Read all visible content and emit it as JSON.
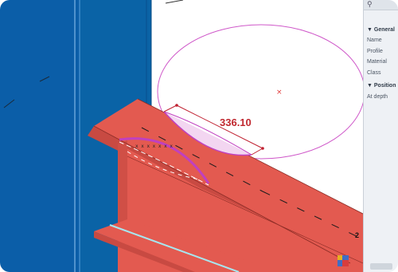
{
  "viewport": {
    "dimension_label": "336.10",
    "axis_label": "2",
    "colors": {
      "blue_left": "#0b5ea8",
      "blue_mid": "#0a63a6",
      "beam_red": "#e35a50",
      "beam_red_dark": "#c84a42",
      "magenta": "#d24bd0",
      "dimension_text": "#c0282f"
    }
  },
  "properties": {
    "sections": [
      {
        "title": "▼ General",
        "items": [
          "Name",
          "Profile",
          "Material",
          "Class"
        ]
      },
      {
        "title": "▼ Position",
        "items": [
          "At depth"
        ]
      }
    ]
  },
  "icons": {
    "search": "magnifier",
    "view_cube": "orientation-cube"
  }
}
